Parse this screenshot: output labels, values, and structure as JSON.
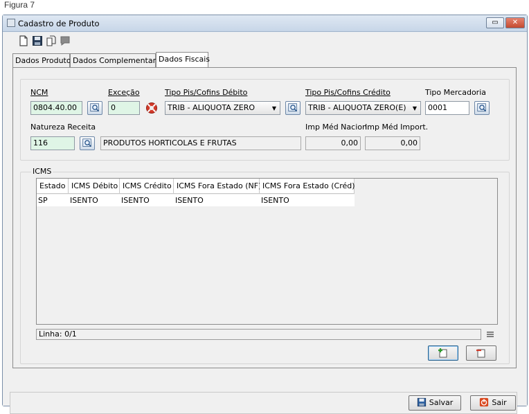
{
  "caption": "Figura 7",
  "window": {
    "title": "Cadastro de Produto"
  },
  "toolbar": {
    "icons": [
      "new-icon",
      "save-icon",
      "copy-icon",
      "comment-icon"
    ]
  },
  "tabs": [
    {
      "label": "Dados Produto",
      "active": false
    },
    {
      "label": "Dados Complementares",
      "active": false
    },
    {
      "label": "Dados Fiscais",
      "active": true
    }
  ],
  "fiscal": {
    "ncm": {
      "label": "NCM",
      "value": "0804.40.00"
    },
    "excecao": {
      "label": "Exceção",
      "value": "0"
    },
    "pis_debito": {
      "label": "Tipo Pis/Cofins Débito",
      "value": "TRIB - ALIQUOTA ZERO"
    },
    "pis_credito": {
      "label": "Tipo Pis/Cofins Crédito",
      "value": "TRIB - ALIQUOTA ZERO(E)"
    },
    "tipo_mercadoria": {
      "label": "Tipo Mercadoria",
      "value": "0001"
    },
    "natureza": {
      "label": "Natureza Receita",
      "value": "116",
      "description": "PRODUTOS HORTICOLAS E FRUTAS"
    },
    "imp_nacion": {
      "label": "Imp Méd Nacion.",
      "value": "0,00"
    },
    "imp_import": {
      "label": "Imp Méd Import.",
      "value": "0,00"
    }
  },
  "icms": {
    "label": "ICMS",
    "columns": [
      "Estado",
      "ICMS Débito",
      "ICMS Crédito",
      "ICMS Fora Estado (NF)",
      "ICMS Fora Estado (Créd)"
    ],
    "rows": [
      [
        "SP",
        "ISENTO",
        "ISENTO",
        "ISENTO",
        "ISENTO"
      ]
    ],
    "status": "Linha: 0/1"
  },
  "buttons": {
    "save": "Salvar",
    "exit": "Sair"
  },
  "colors": {
    "accent": "#3a6ea5",
    "close": "#c44a30",
    "green_field": "#dff5e6"
  }
}
